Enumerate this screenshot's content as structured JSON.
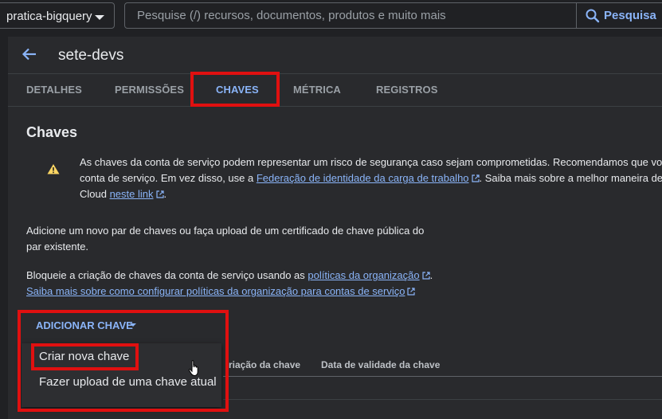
{
  "topbar": {
    "project": "pratica-bigquery",
    "search_placeholder": "Pesquise (/) recursos, documentos, produtos e muito mais",
    "search_button": "Pesquisa"
  },
  "header": {
    "title": "sete-devs"
  },
  "tabs": [
    {
      "label": "DETALHES"
    },
    {
      "label": "PERMISSÕES"
    },
    {
      "label": "CHAVES",
      "active": true
    },
    {
      "label": "MÉTRICA"
    },
    {
      "label": "REGISTROS"
    }
  ],
  "section": {
    "title": "Chaves",
    "warning": {
      "line1": "As chaves da conta de serviço podem representar um risco de segurança caso sejam comprometidas. Recomendamos que voc",
      "line2_pre": "conta de serviço. Em vez disso, use a ",
      "line2_link": "Federação de identidade da carga de trabalho",
      "line2_post": ". Saiba mais sobre a melhor maneira de a",
      "line3_pre": "Cloud ",
      "line3_link": "neste link",
      "line3_post": "."
    },
    "info_line1": "Adicione um novo par de chaves ou faça upload de um certificado de chave pública do",
    "info_line2": "par existente.",
    "block_pre": "Bloqueie a criação de chaves da conta de serviço usando as ",
    "block_link": "políticas da organização",
    "block_post": ".",
    "learn_link": "Saiba mais sobre como configurar políticas da organização para contas de serviço"
  },
  "add_key": {
    "label": "ADICIONAR CHAVE"
  },
  "dropdown": {
    "items": [
      "Criar nova chave",
      "Fazer upload de uma chave atual"
    ]
  },
  "table": {
    "columns": [
      "riação da chave",
      "Data de validade da chave"
    ]
  },
  "colors": {
    "accent": "#8ab4f8",
    "highlight": "#e01010",
    "warning": "#fdd663"
  }
}
